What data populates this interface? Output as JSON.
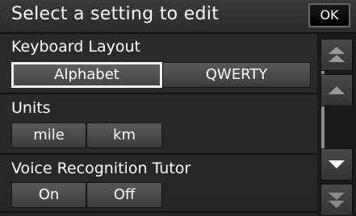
{
  "header": {
    "title": "Select a setting to edit",
    "ok_label": "OK"
  },
  "sections": {
    "keyboard_layout": {
      "label": "Keyboard Layout",
      "options": [
        "Alphabet",
        "QWERTY"
      ],
      "selected": "Alphabet"
    },
    "units": {
      "label": "Units",
      "options": [
        "mile",
        "km"
      ],
      "selected": "mile"
    },
    "voice_tutor": {
      "label": "Voice Recognition Tutor",
      "options": [
        "On",
        "Off"
      ],
      "selected": "On"
    }
  },
  "scroll": {
    "icons": [
      "double-chevron-up-icon",
      "chevron-up-icon",
      "chevron-down-icon",
      "double-chevron-down-icon"
    ]
  }
}
